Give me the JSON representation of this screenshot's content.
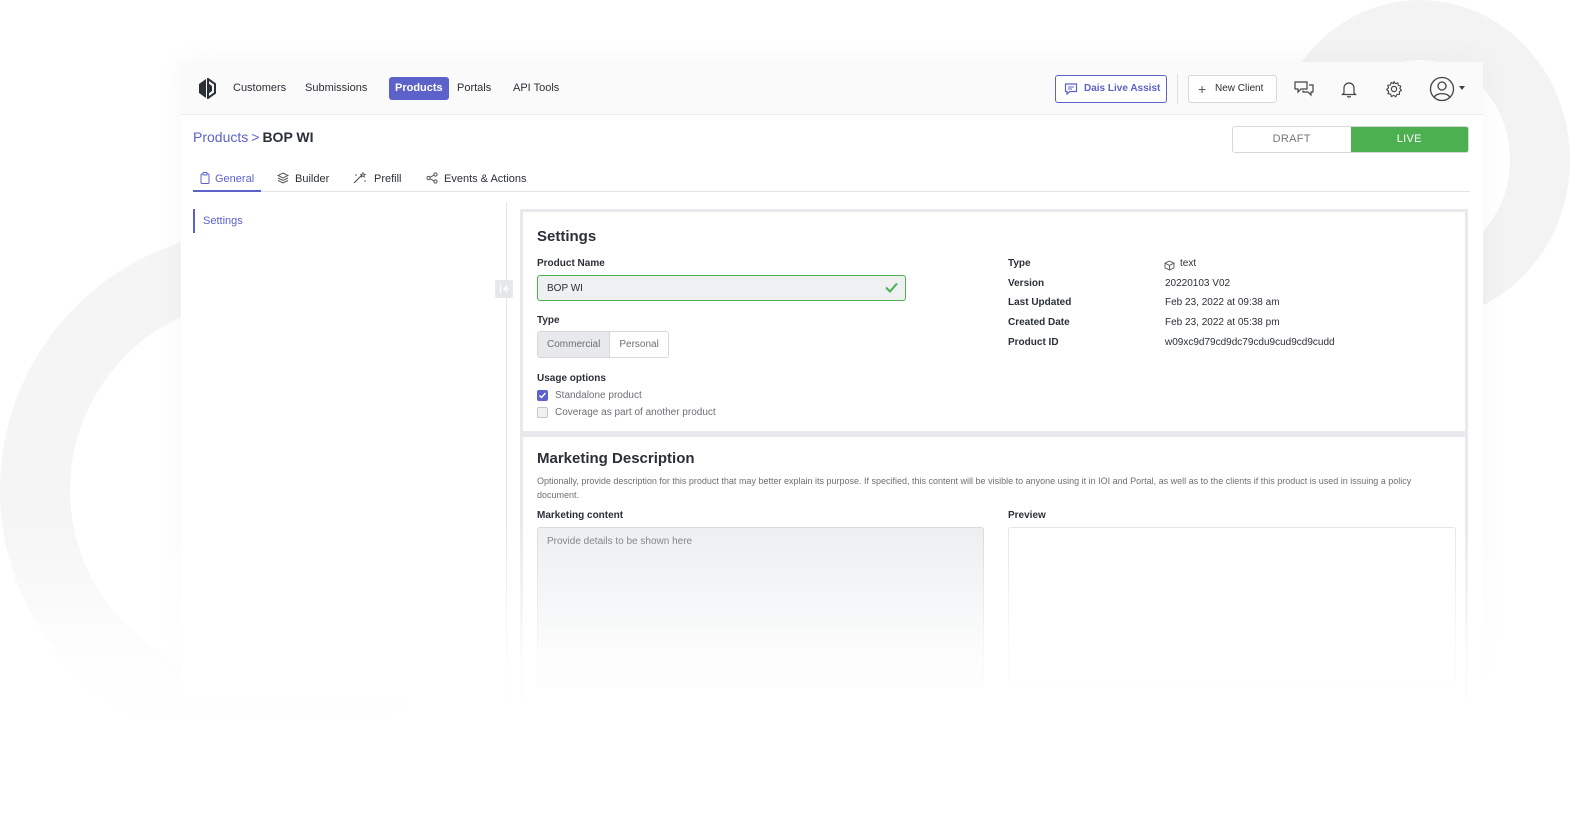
{
  "nav": {
    "items": [
      "Customers",
      "Submissions",
      "Products",
      "Portals",
      "API Tools"
    ],
    "active": "Products",
    "live_assist_label": "Dais Live Assist",
    "new_client_label": "New Client",
    "accent": "#5c62c9"
  },
  "breadcrumb": {
    "parent": "Products",
    "separator": ">",
    "current": "BOP WI"
  },
  "status": {
    "options": [
      "DRAFT",
      "LIVE"
    ],
    "selected": "LIVE",
    "live_color": "#4caf50"
  },
  "tabs": [
    {
      "label": "General",
      "icon": "clipboard-icon",
      "active": true
    },
    {
      "label": "Builder",
      "icon": "layers-icon",
      "active": false
    },
    {
      "label": "Prefill",
      "icon": "wand-icon",
      "active": false
    },
    {
      "label": "Events & Actions",
      "icon": "share-nodes-icon",
      "active": false
    }
  ],
  "sidebar": {
    "items": [
      {
        "label": "Settings",
        "active": true
      }
    ]
  },
  "settings": {
    "title": "Settings",
    "product_name_label": "Product Name",
    "product_name_value": "BOP WI",
    "type_label": "Type",
    "type_options": [
      "Commercial",
      "Personal"
    ],
    "type_selected": "Commercial",
    "usage_label": "Usage options",
    "usage_options": [
      {
        "label": "Standalone product",
        "checked": true
      },
      {
        "label": "Coverage as part of another product",
        "checked": false
      }
    ],
    "meta": [
      {
        "label": "Type",
        "value": "text"
      },
      {
        "label": "Version",
        "value": "20220103 V02"
      },
      {
        "label": "Last Updated",
        "value": "Feb 23, 2022 at 09:38 am"
      },
      {
        "label": "Created Date",
        "value": "Feb 23, 2022 at 05:38 pm"
      },
      {
        "label": "Product ID",
        "value": "w09xc9d79cd9dc79cdu9cud9cd9cudd"
      }
    ]
  },
  "marketing": {
    "title": "Marketing Description",
    "description": "Optionally, provide description for this product that may better explain its purpose. If specified, this content will be visible to anyone using it in IOI and Portal, as well as to the clients if this product is used in issuing a policy document.",
    "content_label": "Marketing content",
    "content_placeholder": "Provide details to be shown here",
    "preview_label": "Preview"
  }
}
